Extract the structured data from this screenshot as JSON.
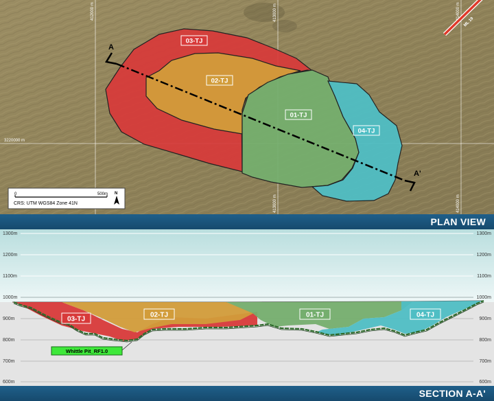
{
  "plan_view": {
    "title": "PLAN VIEW",
    "pits": [
      {
        "label": "03-TJ",
        "color": "#d83a3a"
      },
      {
        "label": "02-TJ",
        "color": "#d09a3a"
      },
      {
        "label": "01-TJ",
        "color": "#6faa6c"
      },
      {
        "label": "04-TJ",
        "color": "#4dbcc2"
      }
    ],
    "section_line": {
      "start_label": "A",
      "end_label": "A'"
    },
    "grid_labels": {
      "easting_left_top": "412000 m",
      "easting_mid_top": "413000 m",
      "easting_right_top": "414000 m",
      "easting_mid_bottom": "413000 m",
      "easting_right_bottom": "414000 m",
      "northing": "3220000 m"
    },
    "road_label": "ML 19",
    "scale_bar": {
      "start": "0",
      "end": "500m"
    },
    "north_label": "N",
    "crs_text": "CRS: UTM WGS84 Zone 41N"
  },
  "section_view": {
    "title": "SECTION A-A'",
    "elevations": [
      "1300m",
      "1200m",
      "1100m",
      "1000m",
      "900m",
      "800m",
      "700m",
      "600m"
    ],
    "pits": [
      {
        "label": "03-TJ",
        "color": "#d83a3a"
      },
      {
        "label": "02-TJ",
        "color": "#d09a3a"
      },
      {
        "label": "01-TJ",
        "color": "#6faa6c"
      },
      {
        "label": "04-TJ",
        "color": "#4dbcc2"
      }
    ],
    "whittle_label": "Whittle Pit_RF1.0"
  }
}
